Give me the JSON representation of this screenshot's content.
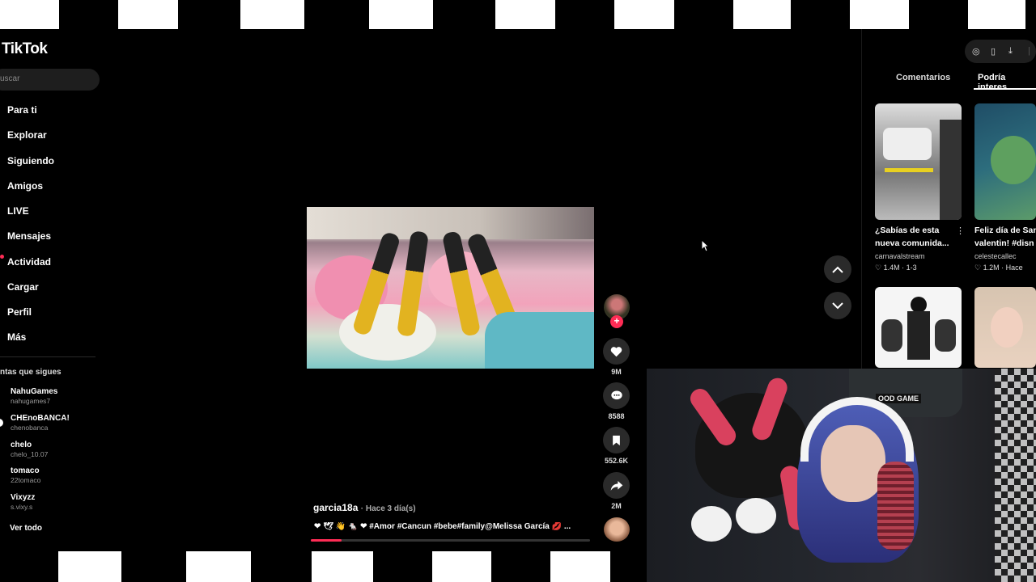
{
  "app": {
    "name": "TikTok"
  },
  "search": {
    "placeholder": "uscar"
  },
  "nav": [
    {
      "label": "Para ti"
    },
    {
      "label": "Explorar"
    },
    {
      "label": "Siguiendo"
    },
    {
      "label": "Amigos"
    },
    {
      "label": "LIVE"
    },
    {
      "label": "Mensajes"
    },
    {
      "label": "Actividad"
    },
    {
      "label": "Cargar"
    },
    {
      "label": "Perfil"
    },
    {
      "label": "Más"
    }
  ],
  "accounts": {
    "heading": "ntas que sigues",
    "items": [
      {
        "name": "NahuGames",
        "user": "nahugames7"
      },
      {
        "name": "CHEnoBANCA!",
        "user": "chenobanca"
      },
      {
        "name": "chelo",
        "user": "chelo_10.07"
      },
      {
        "name": "tomaco",
        "user": "22tomaco"
      },
      {
        "name": "Vixyzz",
        "user": "s.vixy.s"
      }
    ],
    "see_all": "Ver todo"
  },
  "video": {
    "author": "garcia18a",
    "time": "· Hace 3 día(s)",
    "caption": "❤ 🕊 👋 🐁 ❤ #Amor #Cancun #bebe#family@Melissa García 💋 ...",
    "progress": 0.11,
    "likes": "9M",
    "comments": "8588",
    "saves": "552.6K",
    "shares": "2M"
  },
  "right_panel": {
    "tabs": [
      "Comentarios",
      "Podría interes"
    ],
    "cards": [
      {
        "title1": "¿Sabías de esta",
        "title2": "nueva comunida...",
        "user": "carnavalstream",
        "stats": "♡ 1.4M · 1-3"
      },
      {
        "title1": "Feliz día de San",
        "title2": "valentin! #disn",
        "user": "celestecallec",
        "stats": "♡ 1.2M · Hace"
      }
    ]
  },
  "webcam": {
    "chair_label": "OOD GAME"
  },
  "colors": {
    "accent": "#fe2c55",
    "bg": "#000000"
  },
  "icons": [
    "compass-icon",
    "phone-icon",
    "download-icon",
    "heart-icon",
    "comment-icon",
    "bookmark-icon",
    "share-icon",
    "chevron-up-icon",
    "chevron-down-icon",
    "cursor-icon"
  ]
}
